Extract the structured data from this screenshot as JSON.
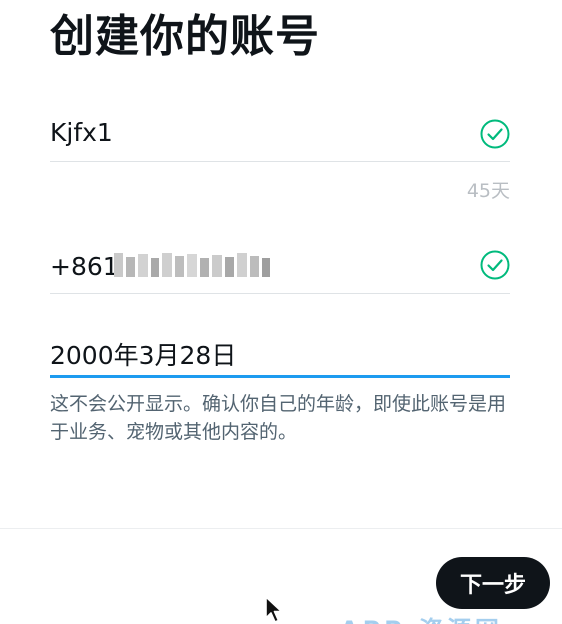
{
  "header": {
    "title": "创建你的账号"
  },
  "form": {
    "name": {
      "value": "Kjfx1",
      "counter": "45天"
    },
    "phone": {
      "value_visible": "+861"
    },
    "birthdate": {
      "value": "2000年3月28日"
    },
    "helper_text": "这不会公开显示。确认你自己的年龄，即使此账号是用于业务、宠物或其他内容的。"
  },
  "footer": {
    "next_label": "下一步"
  },
  "colors": {
    "accent": "#1d9bf0",
    "valid": "#00ba7c",
    "text": "#0f1419",
    "muted": "#536471"
  },
  "icons": {
    "name_valid": "check-circle-icon",
    "phone_valid": "check-circle-icon",
    "cursor": "mouse-pointer-icon"
  }
}
